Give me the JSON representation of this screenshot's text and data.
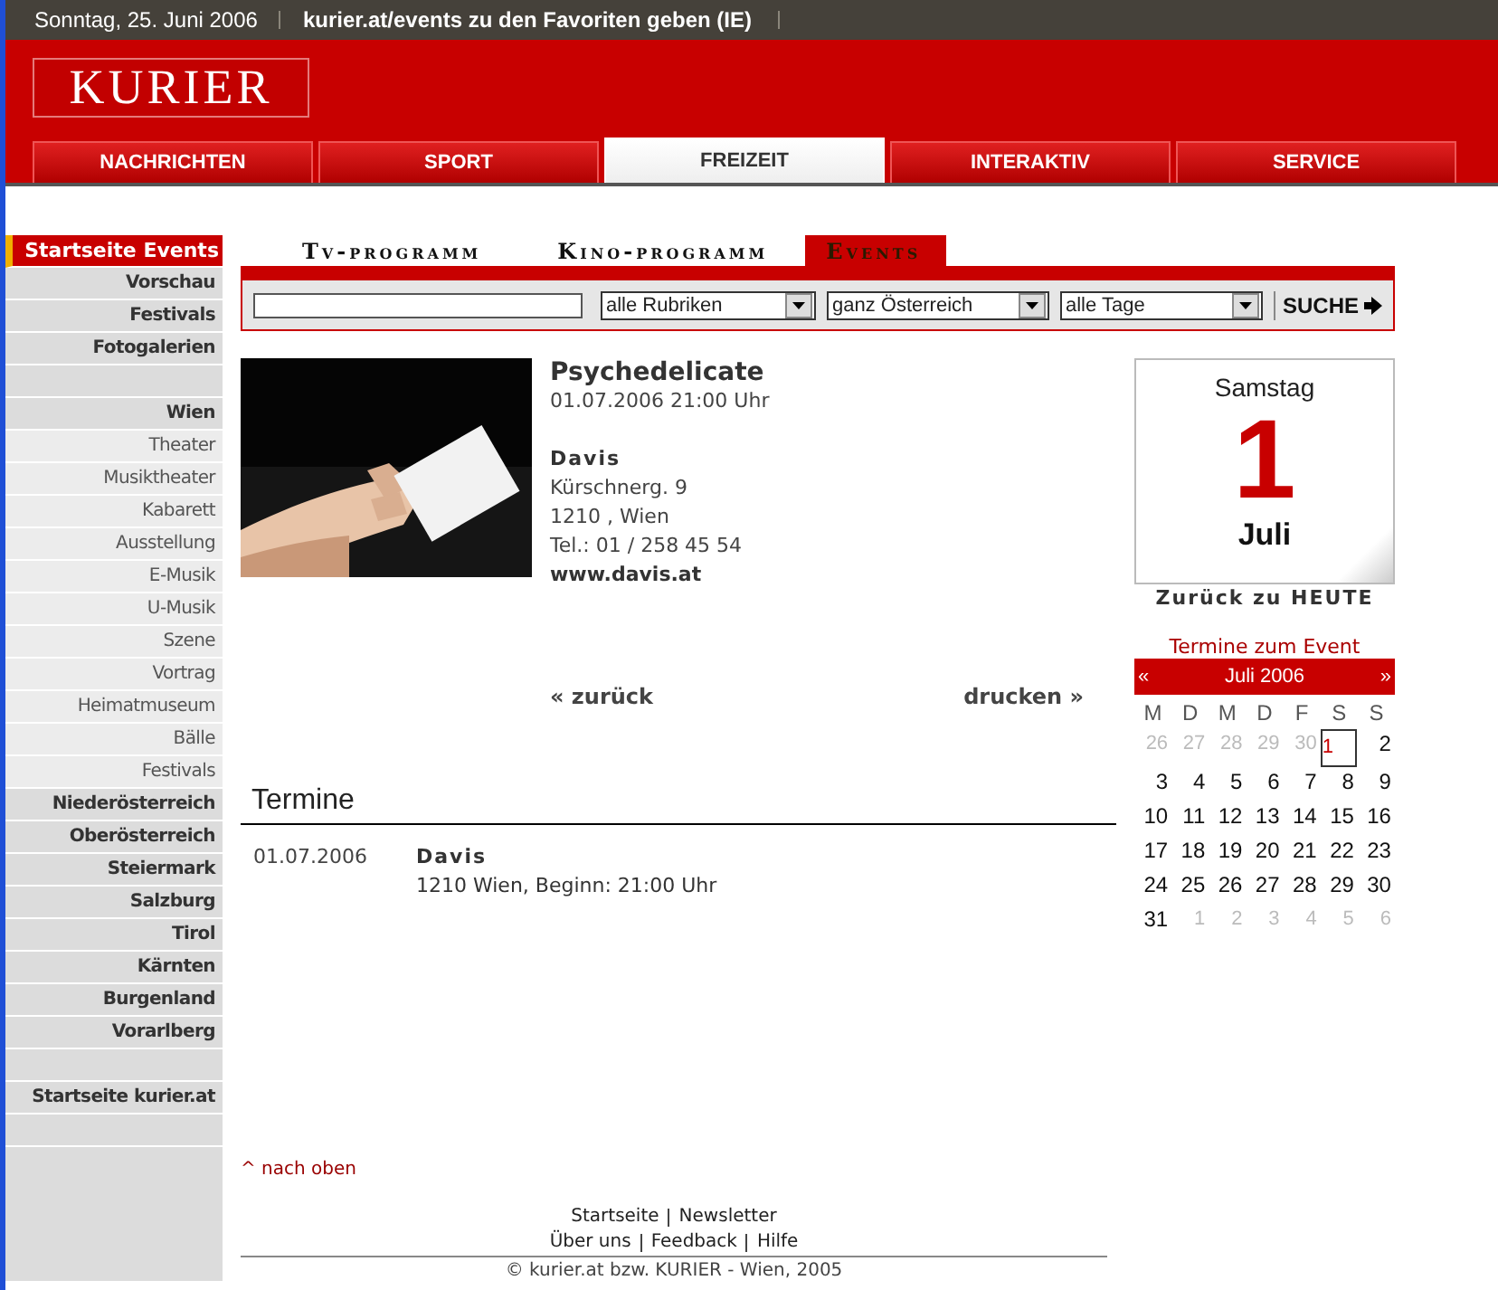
{
  "top_bar": {
    "date": "Sonntag, 25. Juni 2006",
    "link": "kurier.at/events zu den Favoriten geben (IE)"
  },
  "logo": {
    "text": "KURIER"
  },
  "main_tabs": [
    {
      "label": "NACHRICHTEN",
      "selected": false
    },
    {
      "label": "SPORT",
      "selected": false
    },
    {
      "label": "FREIZEIT",
      "selected": true
    },
    {
      "label": "INTERAKTIV",
      "selected": false
    },
    {
      "label": "SERVICE",
      "selected": false
    }
  ],
  "sidebar": {
    "items": [
      {
        "label": "Startseite Events",
        "kind": "main",
        "selected": true
      },
      {
        "label": "Vorschau",
        "kind": "main",
        "selected": false
      },
      {
        "label": "Festivals",
        "kind": "main",
        "selected": false
      },
      {
        "label": "Fotogalerien",
        "kind": "main",
        "selected": false
      },
      {
        "kind": "spacer"
      },
      {
        "label": "Wien",
        "kind": "main",
        "selected": false
      },
      {
        "label": "Theater",
        "kind": "sub",
        "selected": false
      },
      {
        "label": "Musiktheater",
        "kind": "sub",
        "selected": false
      },
      {
        "label": "Kabarett",
        "kind": "sub",
        "selected": false
      },
      {
        "label": "Ausstellung",
        "kind": "sub",
        "selected": false
      },
      {
        "label": "E-Musik",
        "kind": "sub",
        "selected": false
      },
      {
        "label": "U-Musik",
        "kind": "sub",
        "selected": false
      },
      {
        "label": "Szene",
        "kind": "sub",
        "selected": false
      },
      {
        "label": "Vortrag",
        "kind": "sub",
        "selected": false
      },
      {
        "label": "Heimatmuseum",
        "kind": "sub",
        "selected": false
      },
      {
        "label": "Bälle",
        "kind": "sub",
        "selected": false
      },
      {
        "label": "Festivals",
        "kind": "sub",
        "selected": false
      },
      {
        "label": "Niederösterreich",
        "kind": "main",
        "selected": false
      },
      {
        "label": "Oberösterreich",
        "kind": "main",
        "selected": false
      },
      {
        "label": "Steiermark",
        "kind": "main",
        "selected": false
      },
      {
        "label": "Salzburg",
        "kind": "main",
        "selected": false
      },
      {
        "label": "Tirol",
        "kind": "main",
        "selected": false
      },
      {
        "label": "Kärnten",
        "kind": "main",
        "selected": false
      },
      {
        "label": "Burgenland",
        "kind": "main",
        "selected": false
      },
      {
        "label": "Vorarlberg",
        "kind": "main",
        "selected": false
      },
      {
        "kind": "spacer"
      },
      {
        "label": "Startseite kurier.at",
        "kind": "main",
        "selected": false
      },
      {
        "kind": "spacer"
      }
    ]
  },
  "sub_tabs": [
    {
      "label": "Tv-programm",
      "selected": false
    },
    {
      "label": "Kino-programm",
      "selected": false
    },
    {
      "label": "Events",
      "selected": true
    }
  ],
  "search": {
    "selects": [
      "alle Rubriken",
      "ganz Österreich",
      "alle Tage"
    ],
    "button": "SUCHE"
  },
  "event": {
    "title": "Psychedelicate",
    "datetime": "01.07.2006 21:00 Uhr",
    "venue": "Davis",
    "street": "Kürschnerg. 9",
    "city": "1210 , Wien",
    "phone": "Tel.: 01 / 258 45 54",
    "website": "www.davis.at"
  },
  "nav": {
    "back": "« zurück",
    "print": "drucken »"
  },
  "termine": {
    "heading": "Termine",
    "rows": [
      {
        "date": "01.07.2006",
        "venue": "Davis",
        "details": "1210 Wien, Beginn: 21:00 Uhr"
      }
    ]
  },
  "date_tile": {
    "weekday": "Samstag",
    "day": "1",
    "month": "Juli",
    "link": "Zurück zu HEUTE"
  },
  "calendar": {
    "caption": "Termine zum Event",
    "prev": "«",
    "month": "Juli 2006",
    "next": "»",
    "weekdays": [
      "M",
      "D",
      "M",
      "D",
      "F",
      "S",
      "S"
    ],
    "weeks": [
      [
        {
          "day": "26",
          "muted": true,
          "selected": false
        },
        {
          "day": "27",
          "muted": true,
          "selected": false
        },
        {
          "day": "28",
          "muted": true,
          "selected": false
        },
        {
          "day": "29",
          "muted": true,
          "selected": false
        },
        {
          "day": "30",
          "muted": true,
          "selected": false
        },
        {
          "day": "1",
          "muted": false,
          "selected": true
        },
        {
          "day": "2",
          "muted": false,
          "selected": false
        }
      ],
      [
        {
          "day": "3",
          "muted": false,
          "selected": false
        },
        {
          "day": "4",
          "muted": false,
          "selected": false
        },
        {
          "day": "5",
          "muted": false,
          "selected": false
        },
        {
          "day": "6",
          "muted": false,
          "selected": false
        },
        {
          "day": "7",
          "muted": false,
          "selected": false
        },
        {
          "day": "8",
          "muted": false,
          "selected": false
        },
        {
          "day": "9",
          "muted": false,
          "selected": false
        }
      ],
      [
        {
          "day": "10",
          "muted": false,
          "selected": false
        },
        {
          "day": "11",
          "muted": false,
          "selected": false
        },
        {
          "day": "12",
          "muted": false,
          "selected": false
        },
        {
          "day": "13",
          "muted": false,
          "selected": false
        },
        {
          "day": "14",
          "muted": false,
          "selected": false
        },
        {
          "day": "15",
          "muted": false,
          "selected": false
        },
        {
          "day": "16",
          "muted": false,
          "selected": false
        }
      ],
      [
        {
          "day": "17",
          "muted": false,
          "selected": false
        },
        {
          "day": "18",
          "muted": false,
          "selected": false
        },
        {
          "day": "19",
          "muted": false,
          "selected": false
        },
        {
          "day": "20",
          "muted": false,
          "selected": false
        },
        {
          "day": "21",
          "muted": false,
          "selected": false
        },
        {
          "day": "22",
          "muted": false,
          "selected": false
        },
        {
          "day": "23",
          "muted": false,
          "selected": false
        }
      ],
      [
        {
          "day": "24",
          "muted": false,
          "selected": false
        },
        {
          "day": "25",
          "muted": false,
          "selected": false
        },
        {
          "day": "26",
          "muted": false,
          "selected": false
        },
        {
          "day": "27",
          "muted": false,
          "selected": false
        },
        {
          "day": "28",
          "muted": false,
          "selected": false
        },
        {
          "day": "29",
          "muted": false,
          "selected": false
        },
        {
          "day": "30",
          "muted": false,
          "selected": false
        }
      ],
      [
        {
          "day": "31",
          "muted": false,
          "selected": false
        },
        {
          "day": "1",
          "muted": true,
          "selected": false
        },
        {
          "day": "2",
          "muted": true,
          "selected": false
        },
        {
          "day": "3",
          "muted": true,
          "selected": false
        },
        {
          "day": "4",
          "muted": true,
          "selected": false
        },
        {
          "day": "5",
          "muted": true,
          "selected": false
        },
        {
          "day": "6",
          "muted": true,
          "selected": false
        }
      ]
    ]
  },
  "back_to_top": "^ nach oben",
  "footer": {
    "rows": [
      [
        "Startseite",
        "Newsletter"
      ],
      [
        "Über uns",
        "Feedback",
        "Hilfe"
      ]
    ],
    "copyright": "© kurier.at bzw. KURIER - Wien, 2005"
  }
}
